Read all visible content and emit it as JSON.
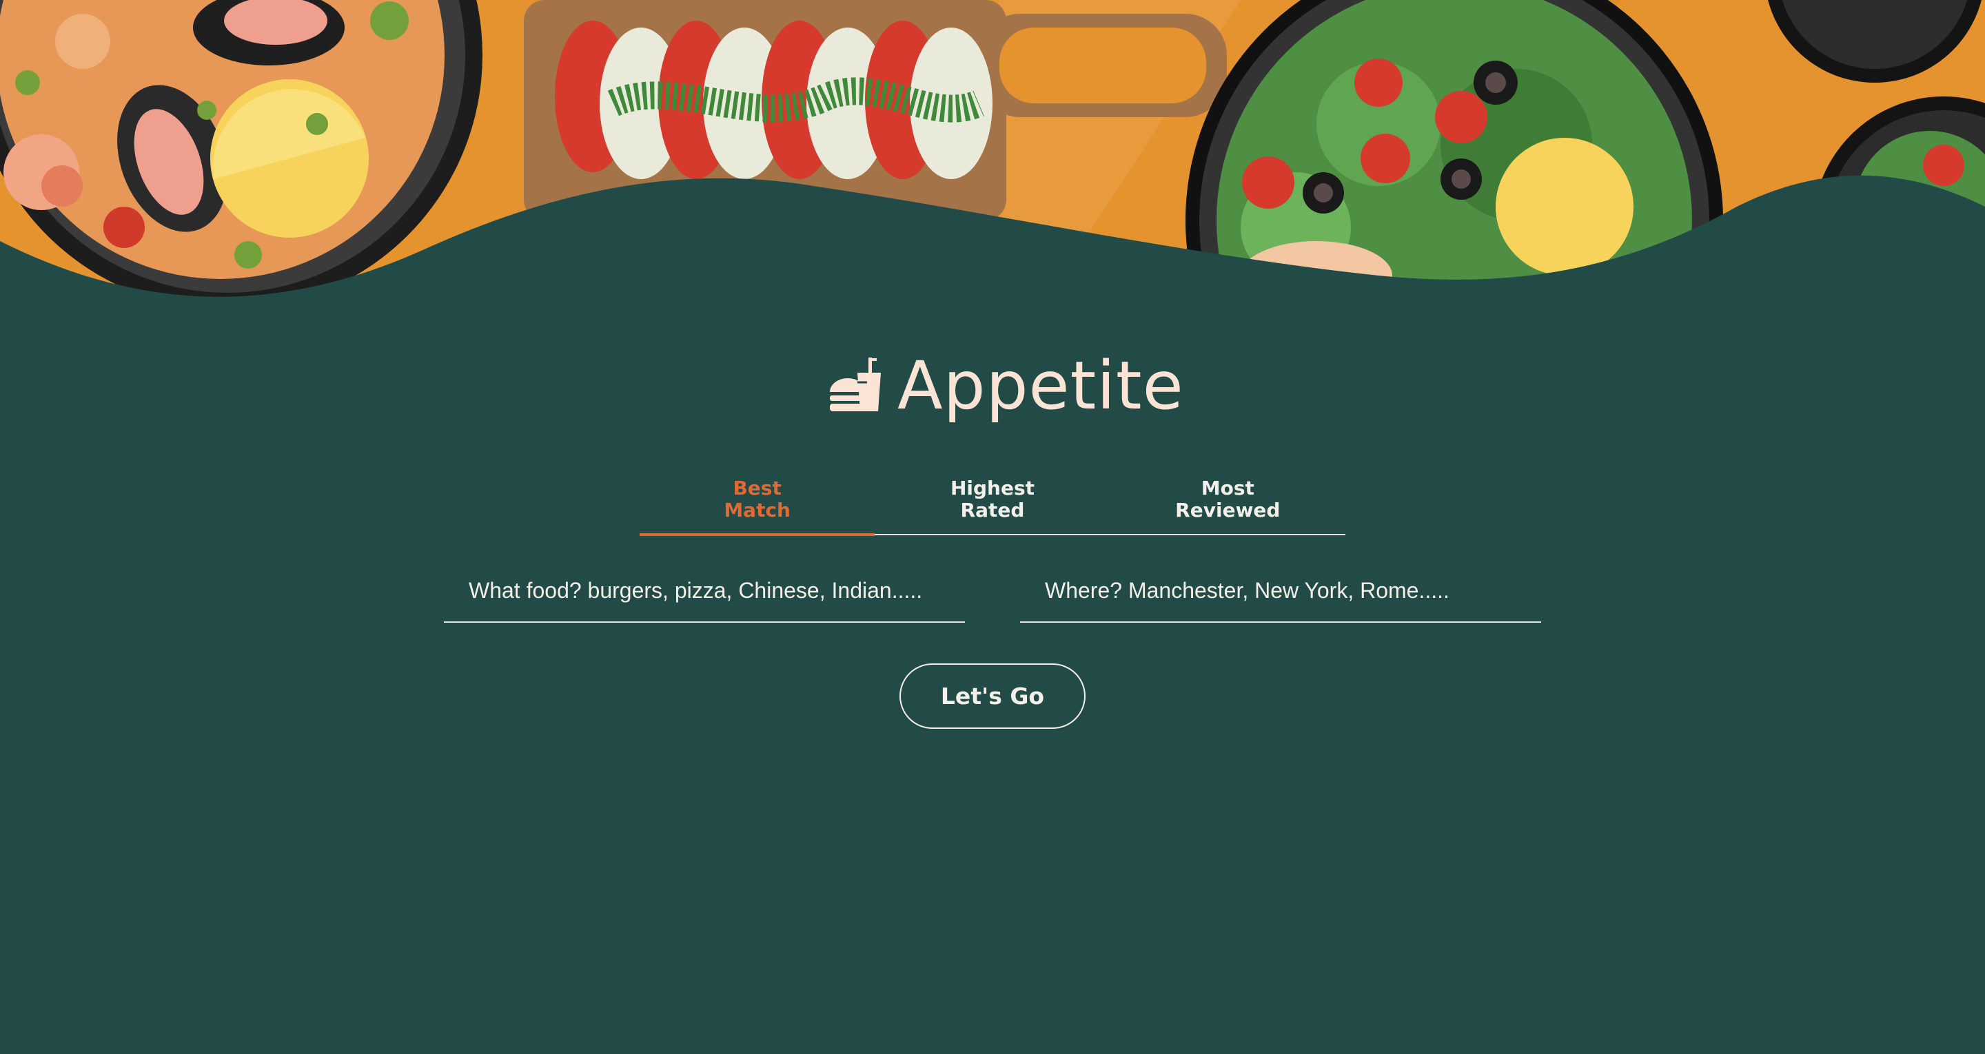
{
  "brand": {
    "name": "Appetite",
    "icon": "burger-and-drink-icon",
    "color": "#fbe3d6"
  },
  "tabs": [
    {
      "label": "Best\nMatch",
      "active": true
    },
    {
      "label": "Highest\nRated",
      "active": false
    },
    {
      "label": "Most\nReviewed",
      "active": false
    }
  ],
  "search": {
    "food_placeholder": "What food? burgers, pizza, Chinese, Indian.....",
    "location_placeholder": "Where? Manchester, New York, Rome.....",
    "submit_label": "Let's Go"
  },
  "colors": {
    "background": "#224a46",
    "accent": "#df6a34",
    "text": "#f3efe9",
    "hero_table": "#e4932f"
  }
}
